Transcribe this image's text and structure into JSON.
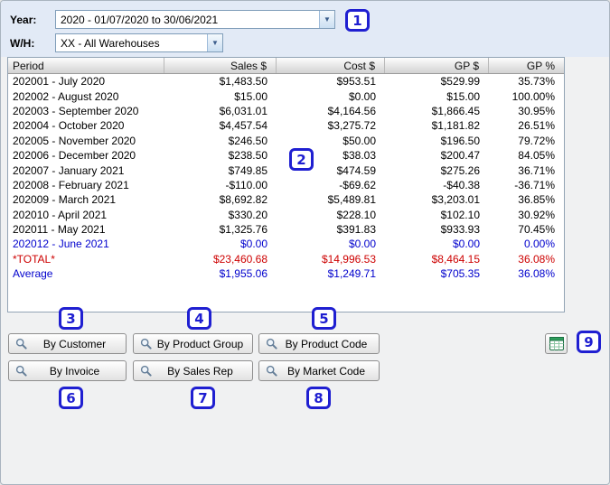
{
  "filters": {
    "year": {
      "label": "Year:",
      "value": "2020 - 01/07/2020 to 30/06/2021"
    },
    "warehouse": {
      "label": "W/H:",
      "value": "XX - All Warehouses"
    }
  },
  "table": {
    "columns": [
      "Period",
      "Sales $",
      "Cost $",
      "GP $",
      "GP %"
    ],
    "rows": [
      {
        "period": "202001 - July 2020",
        "sales": "$1,483.50",
        "cost": "$953.51",
        "gp": "$529.99",
        "gp_pct": "35.73%",
        "variant": "default"
      },
      {
        "period": "202002 - August 2020",
        "sales": "$15.00",
        "cost": "$0.00",
        "gp": "$15.00",
        "gp_pct": "100.00%",
        "variant": "default"
      },
      {
        "period": "202003 - September 2020",
        "sales": "$6,031.01",
        "cost": "$4,164.56",
        "gp": "$1,866.45",
        "gp_pct": "30.95%",
        "variant": "default"
      },
      {
        "period": "202004 - October 2020",
        "sales": "$4,457.54",
        "cost": "$3,275.72",
        "gp": "$1,181.82",
        "gp_pct": "26.51%",
        "variant": "default"
      },
      {
        "period": "202005 - November 2020",
        "sales": "$246.50",
        "cost": "$50.00",
        "gp": "$196.50",
        "gp_pct": "79.72%",
        "variant": "default"
      },
      {
        "period": "202006 - December 2020",
        "sales": "$238.50",
        "cost": "$38.03",
        "gp": "$200.47",
        "gp_pct": "84.05%",
        "variant": "default"
      },
      {
        "period": "202007 - January 2021",
        "sales": "$749.85",
        "cost": "$474.59",
        "gp": "$275.26",
        "gp_pct": "36.71%",
        "variant": "default"
      },
      {
        "period": "202008 - February 2021",
        "sales": "-$110.00",
        "cost": "-$69.62",
        "gp": "-$40.38",
        "gp_pct": "-36.71%",
        "variant": "default"
      },
      {
        "period": "202009 - March 2021",
        "sales": "$8,692.82",
        "cost": "$5,489.81",
        "gp": "$3,203.01",
        "gp_pct": "36.85%",
        "variant": "default"
      },
      {
        "period": "202010 - April 2021",
        "sales": "$330.20",
        "cost": "$228.10",
        "gp": "$102.10",
        "gp_pct": "30.92%",
        "variant": "default"
      },
      {
        "period": "202011 - May 2021",
        "sales": "$1,325.76",
        "cost": "$391.83",
        "gp": "$933.93",
        "gp_pct": "70.45%",
        "variant": "default"
      },
      {
        "period": "202012 - June 2021",
        "sales": "$0.00",
        "cost": "$0.00",
        "gp": "$0.00",
        "gp_pct": "0.00%",
        "variant": "current"
      },
      {
        "period": "*TOTAL*",
        "sales": "$23,460.68",
        "cost": "$14,996.53",
        "gp": "$8,464.15",
        "gp_pct": "36.08%",
        "variant": "total"
      },
      {
        "period": "Average",
        "sales": "$1,955.06",
        "cost": "$1,249.71",
        "gp": "$705.35",
        "gp_pct": "36.08%",
        "variant": "average"
      }
    ]
  },
  "buttons": {
    "by_customer": "By Customer",
    "by_product_group": "By Product Group",
    "by_product_code": "By Product Code",
    "by_invoice": "By Invoice",
    "by_sales_rep": "By Sales Rep",
    "by_market_code": "By Market Code"
  },
  "icons": {
    "search": "search-icon",
    "excel_export": "excel-export-icon",
    "dropdown_arrow": "▼"
  },
  "annotations": [
    "1",
    "2",
    "3",
    "4",
    "5",
    "6",
    "7",
    "8",
    "9"
  ],
  "colors": {
    "current_row": "#0000cd",
    "average_row": "#0000cd",
    "total_row": "#cd0000",
    "annotation": "#1f1fd1",
    "filter_panel": "#e2eaf6"
  }
}
